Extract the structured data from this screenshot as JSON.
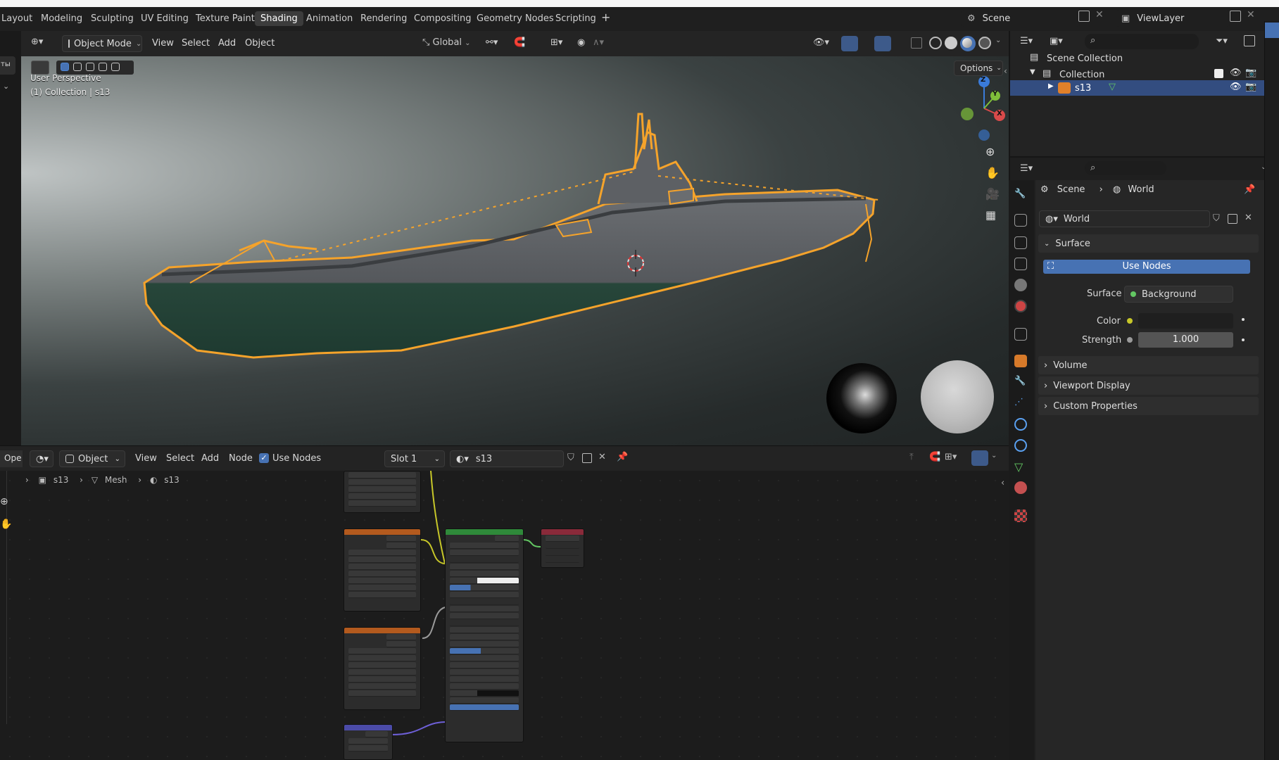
{
  "workspaces": {
    "tabs": [
      "Layout",
      "Modeling",
      "Sculpting",
      "UV Editing",
      "Texture Paint",
      "Shading",
      "Animation",
      "Rendering",
      "Compositing",
      "Geometry Nodes",
      "Scripting"
    ],
    "active": "Shading",
    "add_label": "+",
    "scene_name": "Scene",
    "view_layer_name": "ViewLayer"
  },
  "viewport": {
    "mode": "Object Mode",
    "menus": [
      "View",
      "Select",
      "Add",
      "Object"
    ],
    "transform_orientation": "Global",
    "options_label": "Options",
    "overlay_title": "User Perspective",
    "overlay_subtitle": "(1) Collection | s13",
    "left_tab_text": "ты",
    "gizmo": {
      "z": "Z",
      "y": "Y",
      "x": "X"
    }
  },
  "node_editor": {
    "editor_cut_label": "Ope",
    "object_label": "Object",
    "menus": [
      "View",
      "Select",
      "Add",
      "Node"
    ],
    "use_nodes_label": "Use Nodes",
    "slot_label": "Slot 1",
    "material_name": "s13",
    "breadcrumb": {
      "object": "s13",
      "mesh": "Mesh",
      "material": "s13"
    }
  },
  "outliner": {
    "items": [
      {
        "label": "Scene Collection"
      },
      {
        "label": "Collection"
      },
      {
        "label": "s13"
      }
    ]
  },
  "properties": {
    "breadcrumb": {
      "scene": "Scene",
      "world": "World"
    },
    "world_name": "World",
    "surface_panel": "Surface",
    "use_nodes_button": "Use Nodes",
    "surface_label": "Surface",
    "surface_value": "Background",
    "color_label": "Color",
    "strength_label": "Strength",
    "strength_value": "1.000",
    "collapsed_panels": [
      "Volume",
      "Viewport Display",
      "Custom Properties"
    ]
  },
  "colors": {
    "accent_blue": "#4772b3",
    "selection_orange": "#f5a32b",
    "active_row": "#334d80",
    "socket_yellow": "#c7c729",
    "socket_green": "#63c763"
  }
}
